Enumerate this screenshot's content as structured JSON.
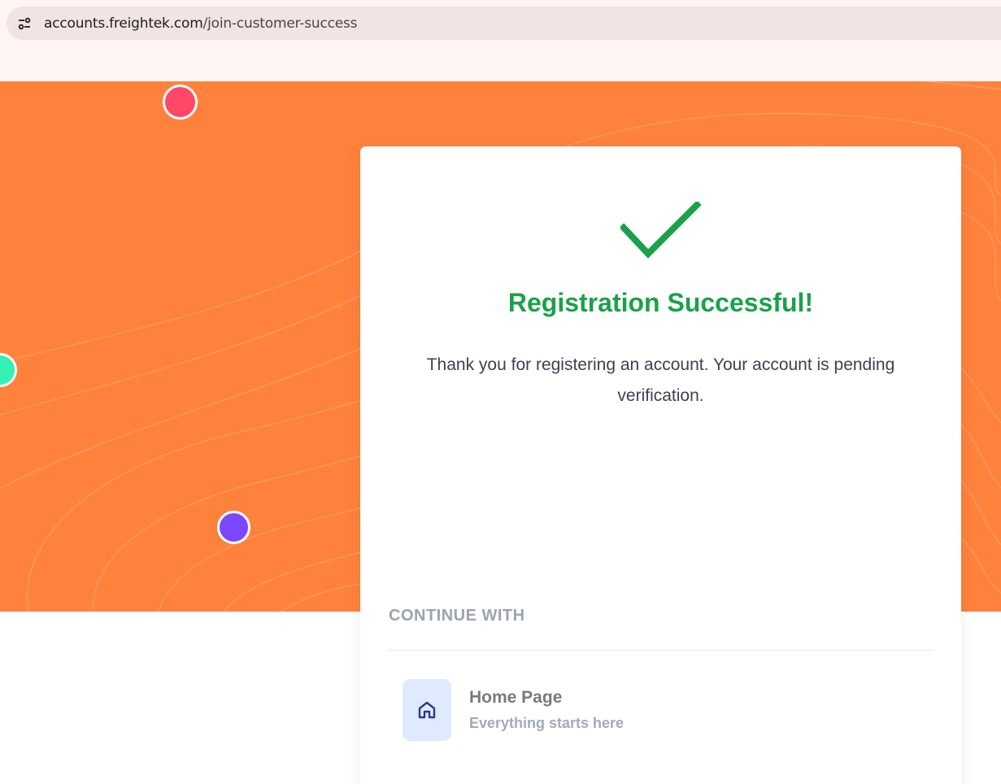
{
  "browser": {
    "url_domain": "accounts.freightek.com",
    "url_path": "/join-customer-success",
    "site_info_icon": "tune-icon"
  },
  "hero": {
    "background_color": "#ff823c",
    "dots": [
      {
        "name": "red",
        "color": "#ff4767"
      },
      {
        "name": "green",
        "color": "#33f0b5"
      },
      {
        "name": "purple",
        "color": "#7b47ff"
      }
    ]
  },
  "card": {
    "status_icon": "checkmark-icon",
    "title": "Registration Successful!",
    "message": "Thank you for registering an account. Your account is pending verification.",
    "continue_label": "CONTINUE WITH",
    "links": [
      {
        "icon": "home-icon",
        "title": "Home Page",
        "subtitle": "Everything starts here"
      }
    ]
  },
  "colors": {
    "success": "#1aa14a",
    "accent": "#ff823c",
    "icon_bg": "#dfeafe",
    "icon_fg": "#2a3a8a"
  }
}
